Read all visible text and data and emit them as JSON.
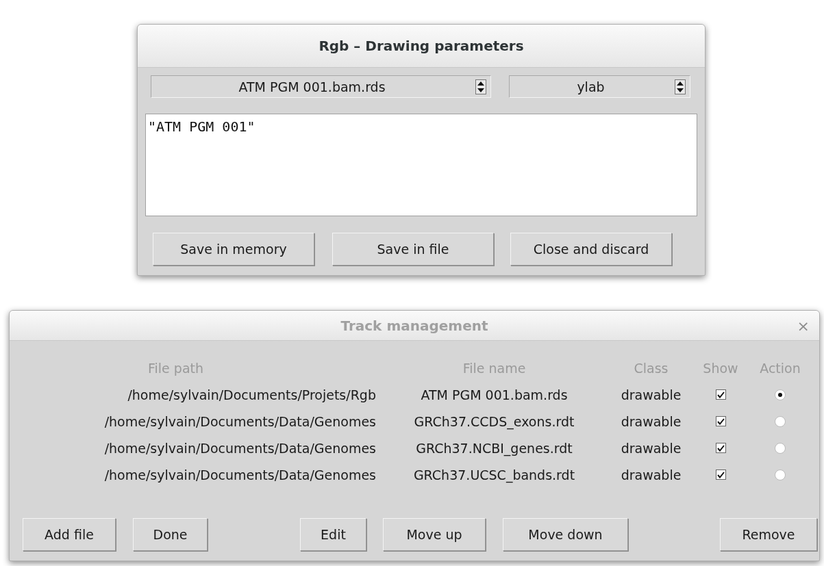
{
  "params_dialog": {
    "title": "Rgb – Drawing parameters",
    "file_spinner": {
      "value": "ATM PGM 001.bam.rds"
    },
    "param_spinner": {
      "value": "ylab"
    },
    "value_text": "\"ATM PGM 001\"",
    "buttons": [
      "Save in memory",
      "Save in file",
      "Close and discard"
    ]
  },
  "track_dialog": {
    "title": "Track management",
    "close": "×",
    "columns": [
      "File path",
      "File name",
      "Class",
      "Show",
      "Action"
    ],
    "rows": [
      {
        "path": "/home/sylvain/Documents/Projets/Rgb",
        "name": "ATM PGM 001.bam.rds",
        "class": "drawable",
        "show": true,
        "selected": true
      },
      {
        "path": "/home/sylvain/Documents/Data/Genomes",
        "name": "GRCh37.CCDS_exons.rdt",
        "class": "drawable",
        "show": true,
        "selected": false
      },
      {
        "path": "/home/sylvain/Documents/Data/Genomes",
        "name": "GRCh37.NCBI_genes.rdt",
        "class": "drawable",
        "show": true,
        "selected": false
      },
      {
        "path": "/home/sylvain/Documents/Data/Genomes",
        "name": "GRCh37.UCSC_bands.rdt",
        "class": "drawable",
        "show": true,
        "selected": false
      }
    ],
    "buttons": [
      "Add file",
      "Done",
      "Edit",
      "Move up",
      "Move down",
      "Remove"
    ]
  }
}
